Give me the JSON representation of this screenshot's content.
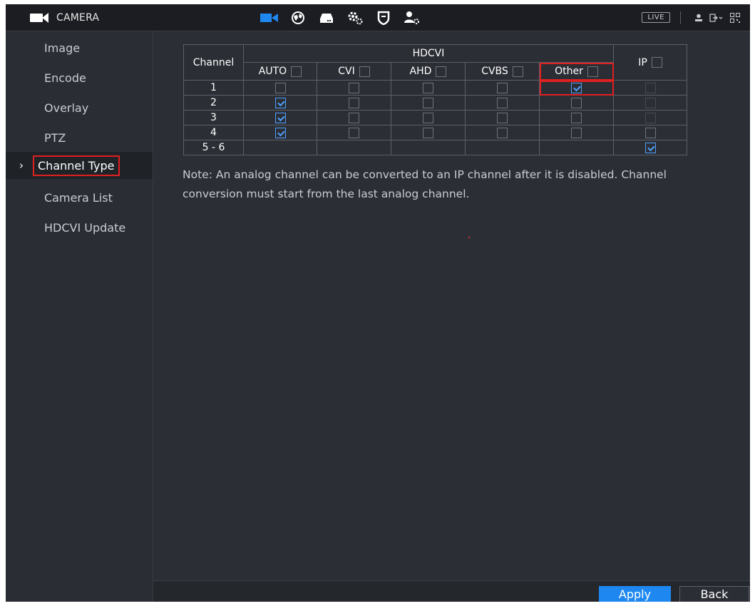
{
  "header": {
    "title": "CAMERA",
    "live_label": "LIVE",
    "nav_icons": [
      "camera-icon",
      "network-globe-icon",
      "storage-hdd-icon",
      "system-gears-icon",
      "security-shield-icon",
      "account-user-icon"
    ]
  },
  "sidebar": {
    "items": [
      {
        "label": "Image"
      },
      {
        "label": "Encode"
      },
      {
        "label": "Overlay"
      },
      {
        "label": "PTZ"
      },
      {
        "label": "Channel Type"
      },
      {
        "label": "Camera List"
      },
      {
        "label": "HDCVI Update"
      }
    ],
    "active_index": 4
  },
  "table": {
    "channel_header": "Channel",
    "group_header": "HDCVI",
    "columns": [
      "AUTO",
      "CVI",
      "AHD",
      "CVBS",
      "Other"
    ],
    "ip_header": "IP",
    "rows": [
      {
        "channel": "1",
        "auto": false,
        "cvi": false,
        "ahd": false,
        "cvbs": false,
        "other": true,
        "ip": false
      },
      {
        "channel": "2",
        "auto": true,
        "cvi": false,
        "ahd": false,
        "cvbs": false,
        "other": false,
        "ip": false
      },
      {
        "channel": "3",
        "auto": true,
        "cvi": false,
        "ahd": false,
        "cvbs": false,
        "other": false,
        "ip": false
      },
      {
        "channel": "4",
        "auto": true,
        "cvi": false,
        "ahd": false,
        "cvbs": false,
        "other": false,
        "ip": false
      },
      {
        "channel": "5 - 6",
        "ip": true
      }
    ]
  },
  "note": "Note: An analog channel can be converted to an IP channel after it is disabled. Channel conversion must start from the last analog channel.",
  "buttons": {
    "apply": "Apply",
    "back": "Back"
  },
  "colors": {
    "accent": "#1e88f0",
    "highlight": "#e02020",
    "background": "#2b2e35"
  }
}
